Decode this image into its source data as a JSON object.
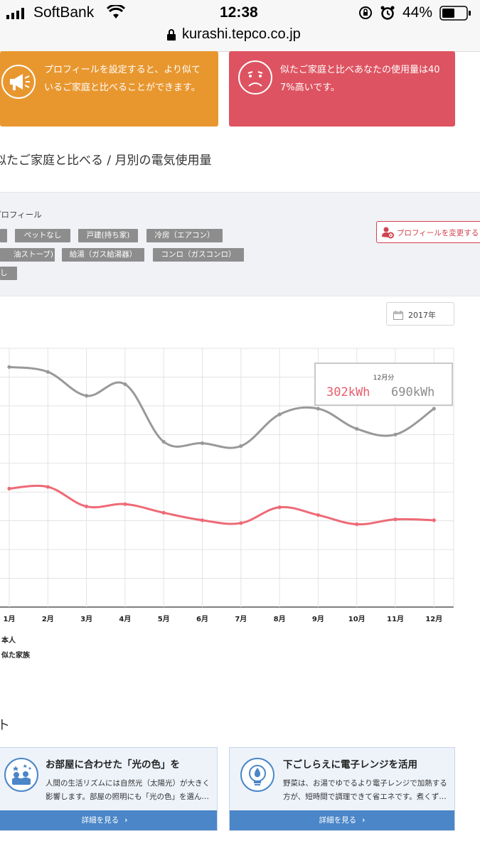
{
  "status_bar": {
    "carrier": "SoftBank",
    "time": "12:38",
    "battery": "44%",
    "url": "kurashi.tepco.co.jp"
  },
  "cards": {
    "profile_notice": "プロフィールを設定すると、より似ているご家庭と比べることができます。",
    "profile_notice_l1": "プロフィールを設定すると、より似て",
    "profile_notice_l2": "いるご家庭と比べることができます。",
    "usage_notice_l1": "似たご家庭と比べあなたの使用量は40",
    "usage_notice_l2": "7%高いです。"
  },
  "section_title": "似たご家庭と比べる / 月別の電気使用量",
  "profile": {
    "heading": "プロフィール",
    "tags": [
      "",
      "ペットなし",
      "戸建(持ち家)",
      "冷房（エアコン）",
      "油ストーブ)",
      "給湯（ガス給湯器）",
      "コンロ（ガスコンロ）",
      "し"
    ],
    "change_button": "プロフィールを変更する"
  },
  "year_selector": "2017年",
  "tooltip": {
    "title": "12月分",
    "self_value": "302kWh",
    "family_value": "690kWh"
  },
  "legend": {
    "self": "本人",
    "family": "似た家族"
  },
  "colors": {
    "orange": "#e8972f",
    "red": "#de5361",
    "self_line": "#ee6a76",
    "family_line": "#999999",
    "button_blue": "#4a86c8"
  },
  "chart_data": {
    "type": "line",
    "categories": [
      "1月",
      "2月",
      "3月",
      "4月",
      "5月",
      "6月",
      "7月",
      "8月",
      "9月",
      "10月",
      "11月",
      "12月"
    ],
    "series": [
      {
        "name": "似た家族",
        "values": [
          835,
          818,
          735,
          775,
          575,
          570,
          560,
          670,
          690,
          620,
          600,
          690
        ]
      },
      {
        "name": "本人",
        "values": [
          412,
          418,
          350,
          358,
          328,
          302,
          292,
          347,
          320,
          288,
          305,
          302
        ]
      }
    ],
    "ylim": [
      0,
      900
    ],
    "grid": true
  },
  "tips": {
    "heading": "ト",
    "items": [
      {
        "title": "お部屋に合わせた「光の色」を",
        "line1": "人間の生活リズムには自然光（太陽光）が大きく",
        "line2": "影響します。部屋の照明にも「光の色」を選ん…",
        "link": "詳細を見る"
      },
      {
        "title": "下ごしらえに電子レンジを活用",
        "line1": "野菜は、お湯でゆでるより電子レンジで加熱する",
        "line2": "方が、短時間で調理できて省エネです。煮くず…",
        "link": "詳細を見る"
      }
    ]
  }
}
